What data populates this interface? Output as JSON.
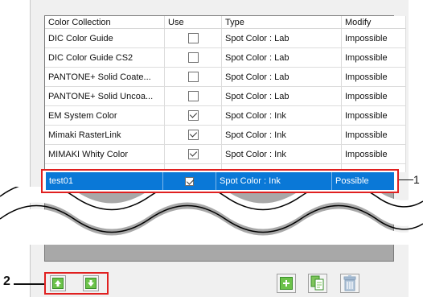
{
  "table": {
    "headers": {
      "name": "Color Collection",
      "use": "Use",
      "type": "Type",
      "modify": "Modify"
    },
    "rows": [
      {
        "name": "DIC Color Guide",
        "use": false,
        "type": "Spot Color : Lab",
        "modify": "Impossible"
      },
      {
        "name": "DIC Color Guide CS2",
        "use": false,
        "type": "Spot Color : Lab",
        "modify": "Impossible"
      },
      {
        "name": "PANTONE+ Solid Coate...",
        "use": false,
        "type": "Spot Color : Lab",
        "modify": "Impossible"
      },
      {
        "name": "PANTONE+ Solid Uncoa...",
        "use": false,
        "type": "Spot Color : Lab",
        "modify": "Impossible"
      },
      {
        "name": "EM System Color",
        "use": true,
        "type": "Spot Color : Ink",
        "modify": "Impossible"
      },
      {
        "name": "Mimaki RasterLink",
        "use": true,
        "type": "Spot Color : Ink",
        "modify": "Impossible"
      },
      {
        "name": "MIMAKI Whity Color",
        "use": true,
        "type": "Spot Color : Ink",
        "modify": "Impossible"
      }
    ],
    "selected": {
      "name": "test01",
      "use": true,
      "type": "Spot Color : Ink",
      "modify": "Possible"
    }
  },
  "callouts": {
    "right": "1",
    "left": "2"
  },
  "buttons": {
    "up": "up-arrow-icon",
    "down": "down-arrow-icon",
    "add": "plus-icon",
    "copy": "copy-pages-icon",
    "delete": "trash-icon"
  },
  "colors": {
    "highlight": "#e02020",
    "selection": "#0a78d7",
    "button_green": "#6cc24a"
  }
}
